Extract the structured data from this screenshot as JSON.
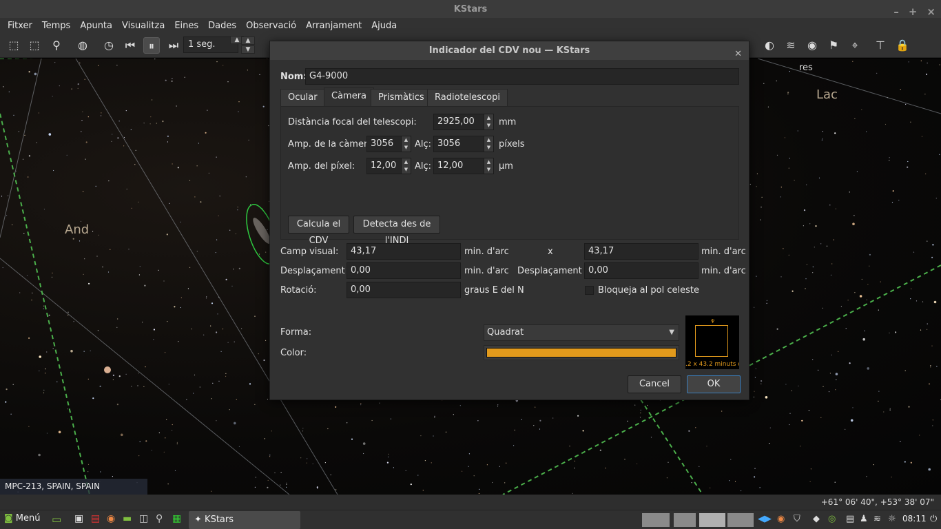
{
  "window": {
    "title": "KStars",
    "controls": [
      "–",
      "+",
      "×"
    ]
  },
  "menu": [
    "Fitxer",
    "Temps",
    "Apunta",
    "Visualitza",
    "Eines",
    "Dades",
    "Observació",
    "Arranjament",
    "Ajuda"
  ],
  "toolbar": {
    "time_step": "1 seg."
  },
  "sky": {
    "labels": [
      "And",
      "Lac",
      "res"
    ],
    "location": "MPC-213, SPAIN, SPAIN",
    "coords": "+61° 06' 40\", +53° 38' 07\""
  },
  "dialog": {
    "title": "Indicador del CDV nou — KStars",
    "name_label": "Nom:",
    "name_value": "G4-9000",
    "tabs": [
      "Ocular",
      "Càmera",
      "Prismàtics",
      "Radiotelescopi"
    ],
    "camera": {
      "focal_label": "Distància focal del telescopi:",
      "focal_value": "2925,00",
      "focal_unit": "mm",
      "width_label": "Amp. de la càmera:",
      "width_value": "3056",
      "height_label": "Alç:",
      "height_value": "3056",
      "pixels_unit": "píxels",
      "pxw_label": "Amp. del píxel:",
      "pxw_value": "12,00",
      "pxh_label": "Alç:",
      "pxh_value": "12,00",
      "um_unit": "µm",
      "calc_button": "Calcula el CDV",
      "indi_button": "Detecta des de l'INDI"
    },
    "fov_label": "Camp visual:",
    "fov_x": "43,17",
    "fov_unit1": "min. d'arc",
    "fov_sep": "x",
    "fov_y": "43,17",
    "fov_unit2": "min. d'arc",
    "offx_label": "Desplaçament X:",
    "offx_value": "0,00",
    "offx_unit": "min. d'arc",
    "offy_label": "Desplaçament Y:",
    "offy_value": "0,00",
    "offy_unit": "min. d'arc",
    "rot_label": "Rotació:",
    "rot_value": "0,00",
    "rot_unit": "graus E del N",
    "lock_label": "Bloqueja al pol celeste",
    "shape_label": "Forma:",
    "shape_value": "Quadrat",
    "color_label": "Color:",
    "color_value": "#e29a1c",
    "preview_text": ".2 x 43.2 minuts d'a",
    "cancel": "Cancel",
    "ok": "OK"
  },
  "taskbar": {
    "menu": "Menú",
    "task": "KStars",
    "clock": "08:11"
  }
}
